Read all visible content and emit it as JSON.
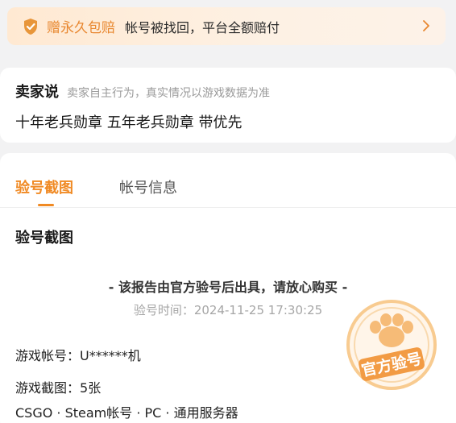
{
  "guarantee": {
    "title": "赠永久包赔",
    "desc": "帐号被找回，平台全额赔付",
    "icon": "shield-check-icon",
    "accent": "#e8872f"
  },
  "seller": {
    "title": "卖家说",
    "note": "卖家自主行为，真实情况以游戏数据为准",
    "text": "十年老兵勋章 五年老兵勋章 带优先"
  },
  "tabs": [
    {
      "label": "验号截图",
      "active": true
    },
    {
      "label": "帐号信息",
      "active": false
    }
  ],
  "section": {
    "title": "验号截图",
    "report": "- 该报告由官方验号后出具，请放心购买 -",
    "time_label": "验号时间：",
    "time_value": "2024-11-25 17:30:25",
    "stamp_text": "官方验号"
  },
  "info": {
    "account_label": "游戏帐号：",
    "account_value": "U******机",
    "screens_label": "游戏截图：",
    "screens_value": "5张",
    "tags": "CSGO · Steam帐号 · PC · 通用服务器"
  }
}
